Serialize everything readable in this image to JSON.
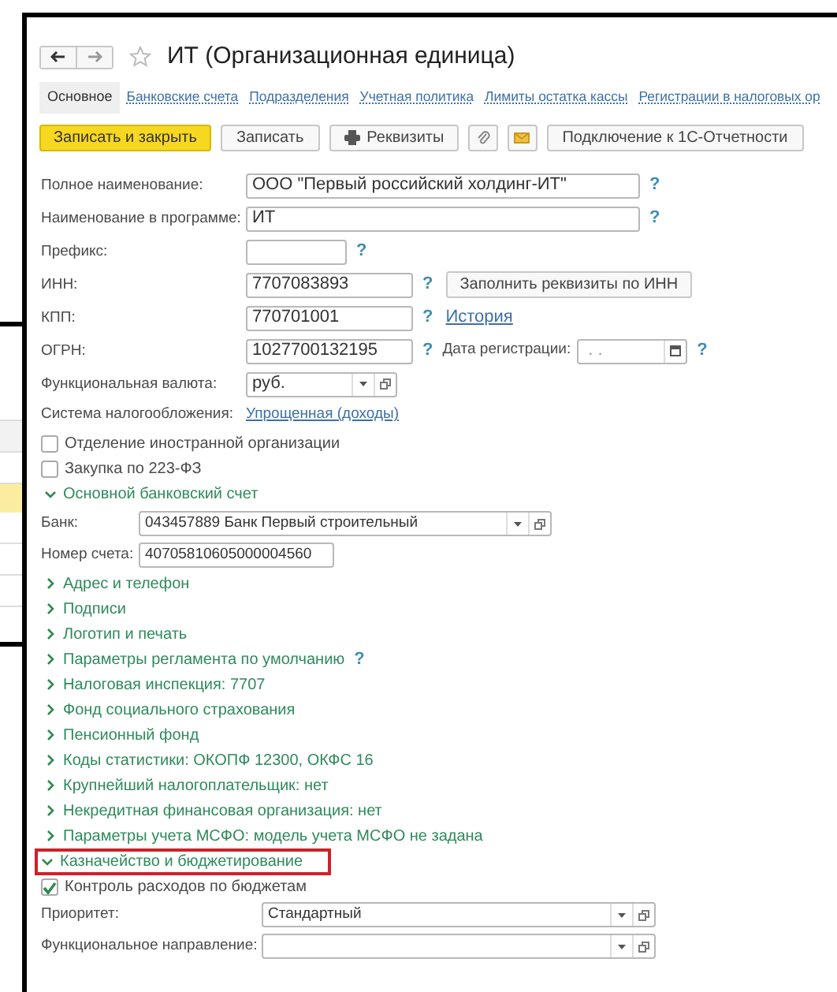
{
  "window": {
    "title": "ИТ (Организационная единица)",
    "favorite": false
  },
  "tabs": [
    {
      "label": "Основное",
      "selected": true
    },
    {
      "label": "Банковские счета",
      "selected": false
    },
    {
      "label": "Подразделения",
      "selected": false
    },
    {
      "label": "Учетная политика",
      "selected": false
    },
    {
      "label": "Лимиты остатка кассы",
      "selected": false
    },
    {
      "label": "Регистрации в налоговых ор",
      "selected": false
    }
  ],
  "toolbar": [
    {
      "kind": "primary",
      "label": "Записать и закрыть"
    },
    {
      "kind": "plain",
      "label": "Записать"
    },
    {
      "kind": "print",
      "label": "Реквизиты"
    },
    {
      "kind": "clip"
    },
    {
      "kind": "mail"
    },
    {
      "kind": "plain",
      "label": "Подключение к 1С-Отчетности"
    }
  ],
  "main_fields": [
    {
      "kind": "wide",
      "label": "Полное наименование:",
      "value": "ООО \"Первый российский холдинг-ИТ\"",
      "help": "?"
    },
    {
      "kind": "wide",
      "label": "Наименование в программе:",
      "value": "ИТ",
      "help": "?"
    },
    {
      "kind": "small",
      "label": "Префикс:",
      "help": "?"
    },
    {
      "kind": "medium",
      "label": "ИНН:",
      "value": "7707083893",
      "help": "?",
      "button": "Заполнить реквизиты по ИНН"
    },
    {
      "kind": "medium",
      "label": "КПП:",
      "value": "770701001",
      "help": "?",
      "link": "История"
    },
    {
      "kind": "medium",
      "label": "ОГРН:",
      "value": "1027700132195",
      "help": "?",
      "date": {
        "label": "Дата регистрации:",
        "placeholder": ". .",
        "help": "?"
      }
    },
    {
      "kind": "select",
      "label": "Функциональная валюта:",
      "value": "руб."
    }
  ],
  "taxation": {
    "label": "Система налогообложения:",
    "link": "Упрощенная (доходы)"
  },
  "checkboxes": [
    {
      "label": "Отделение иностранной организации",
      "checked": false
    },
    {
      "label": "Закупка по 223-ФЗ",
      "checked": false
    }
  ],
  "bank_group": {
    "title": "Основной банковский счет",
    "expanded": true,
    "bank": {
      "label": "Банк:",
      "value": "043457889 Банк Первый строительный"
    },
    "account": {
      "label": "Номер счета:",
      "value": "40705810605000004560"
    }
  },
  "groups": [
    {
      "title": "Адрес и телефон",
      "expanded": false
    },
    {
      "title": "Подписи",
      "expanded": false
    },
    {
      "title": "Логотип и печать",
      "expanded": false
    },
    {
      "title": "Параметры регламента по умолчанию",
      "expanded": false,
      "help": "?"
    },
    {
      "title": "Налоговая инспекция: 7707",
      "expanded": false
    },
    {
      "title": "Фонд социального страхования",
      "expanded": false
    },
    {
      "title": "Пенсионный фонд",
      "expanded": false
    },
    {
      "title": "Коды статистики: ОКОПФ 12300, ОКФС 16",
      "expanded": false
    },
    {
      "title": "Крупнейший налогоплательщик: нет",
      "expanded": false
    },
    {
      "title": "Некредитная финансовая организация: нет",
      "expanded": false
    },
    {
      "title": "Параметры учета МСФО:  модель учета МСФО не задана",
      "expanded": false
    }
  ],
  "treasury": {
    "title": "Казначейство и бюджетирование",
    "expanded": true,
    "highlighted": true,
    "check": {
      "label": "Контроль расходов по бюджетам",
      "checked": true
    },
    "selects": [
      {
        "label": "Приоритет:",
        "value": "Стандартный"
      },
      {
        "label": "Функциональное направление:"
      }
    ]
  }
}
